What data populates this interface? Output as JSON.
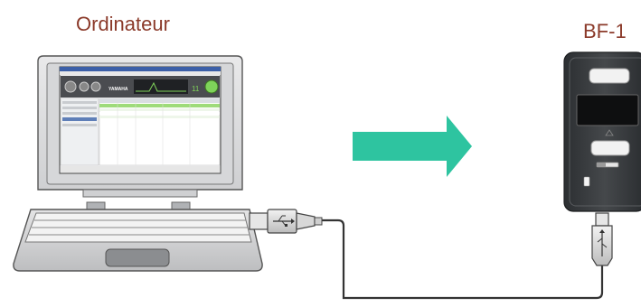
{
  "labels": {
    "computer": "Ordinateur",
    "device": "BF-1"
  },
  "screen_app": {
    "brand": "YAMAHA",
    "readout": "11"
  },
  "colors": {
    "label_text": "#8b3a2a",
    "arrow": "#2ec4a0",
    "cable": "#333333",
    "screen_accent": "#7fd35a",
    "device_body": "#3a3d40"
  }
}
